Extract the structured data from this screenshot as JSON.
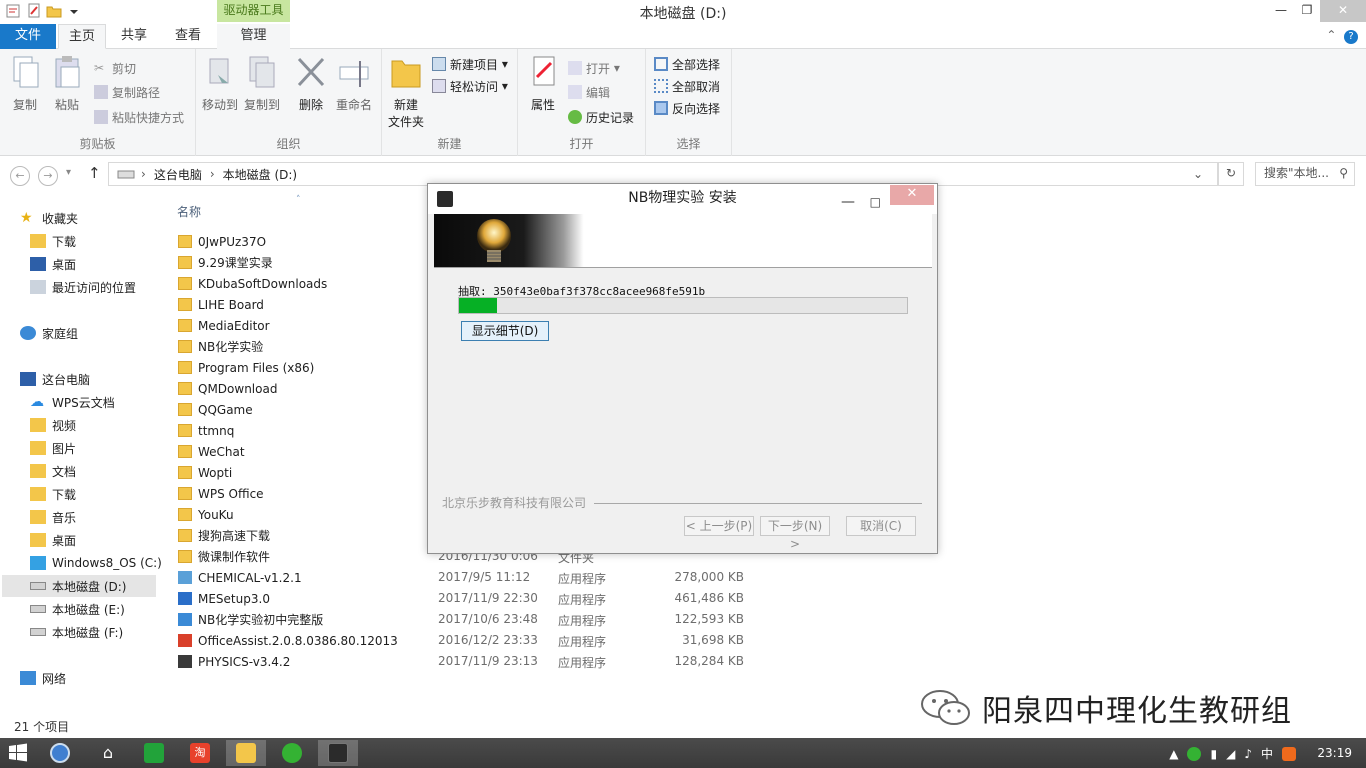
{
  "window": {
    "title": "本地磁盘 (D:)",
    "context_tab_header": "驱动器工具"
  },
  "ribbon_tabs": [
    "文件",
    "主页",
    "共享",
    "查看",
    "管理"
  ],
  "ribbon": {
    "clipboard": {
      "label": "剪贴板",
      "copy": "复制",
      "paste": "粘贴",
      "cut": "剪切",
      "copy_path": "复制路径",
      "paste_shortcut": "粘贴快捷方式"
    },
    "organize": {
      "label": "组织",
      "move_to": "移动到",
      "copy_to": "复制到",
      "delete": "删除",
      "rename": "重命名"
    },
    "new": {
      "label": "新建",
      "new_folder": "新建\n文件夹",
      "new_folder_l1": "新建",
      "new_folder_l2": "文件夹",
      "new_item": "新建项目",
      "easy_access": "轻松访问"
    },
    "open": {
      "label": "打开",
      "properties": "属性",
      "open": "打开",
      "edit": "编辑",
      "history": "历史记录"
    },
    "select": {
      "label": "选择",
      "select_all": "全部选择",
      "select_none": "全部取消",
      "invert": "反向选择"
    }
  },
  "address": {
    "crumbs": [
      "这台电脑",
      "本地磁盘 (D:)"
    ],
    "search_placeholder": "搜索\"本地..."
  },
  "nav": {
    "favorites": "收藏夹",
    "fav_items": [
      "下载",
      "桌面",
      "最近访问的位置"
    ],
    "homegroup": "家庭组",
    "thispc": "这台电脑",
    "pc_items": [
      "WPS云文档",
      "视频",
      "图片",
      "文档",
      "下载",
      "音乐",
      "桌面",
      "Windows8_OS (C:)",
      "本地磁盘 (D:)",
      "本地磁盘 (E:)",
      "本地磁盘 (F:)"
    ],
    "network": "网络"
  },
  "filelist": {
    "col_name": "名称",
    "folders": [
      "0JwPUz37O",
      "9.29课堂实录",
      "KDubaSoftDownloads",
      "LIHE Board",
      "MediaEditor",
      "NB化学实验",
      "Program Files (x86)",
      "QMDownload",
      "QQGame",
      "ttmnq",
      "WeChat",
      "Wopti",
      "WPS Office",
      "YouKu",
      "搜狗高速下载",
      "微课制作软件"
    ],
    "partial_row": {
      "date": "2016/11/30 0:06",
      "type": "文件夹"
    },
    "apps": [
      {
        "name": "CHEMICAL-v1.2.1",
        "date": "2017/9/5 11:12",
        "type": "应用程序",
        "size": "278,000 KB"
      },
      {
        "name": "MESetup3.0",
        "date": "2017/11/9 22:30",
        "type": "应用程序",
        "size": "461,486 KB"
      },
      {
        "name": "NB化学实验初中完整版",
        "date": "2017/10/6 23:48",
        "type": "应用程序",
        "size": "122,593 KB"
      },
      {
        "name": "OfficeAssist.2.0.8.0386.80.12013",
        "date": "2016/12/2 23:33",
        "type": "应用程序",
        "size": "31,698 KB"
      },
      {
        "name": "PHYSICS-v3.4.2",
        "date": "2017/11/9 23:13",
        "type": "应用程序",
        "size": "128,284 KB"
      }
    ]
  },
  "status": {
    "item_count": "21 个项目"
  },
  "watermark": "阳泉四中理化生教研组",
  "dialog": {
    "title": "NB物理实验 安装",
    "extract_text": "抽取: 350f43e0baf3f378cc8acee968fe591b",
    "progress_fraction": 0.085,
    "detail_button": "显示细节(D)",
    "company": "北京乐步教育科技有限公司",
    "back_button": "< 上一步(P)",
    "next_button": "下一步(N) >",
    "cancel_button": "取消(C)"
  },
  "taskbar": {
    "time": "23:19",
    "ime": "中"
  },
  "colors": {
    "accent": "#1979ca",
    "progress": "#06b025",
    "context_tab": "#c8e6a0"
  }
}
